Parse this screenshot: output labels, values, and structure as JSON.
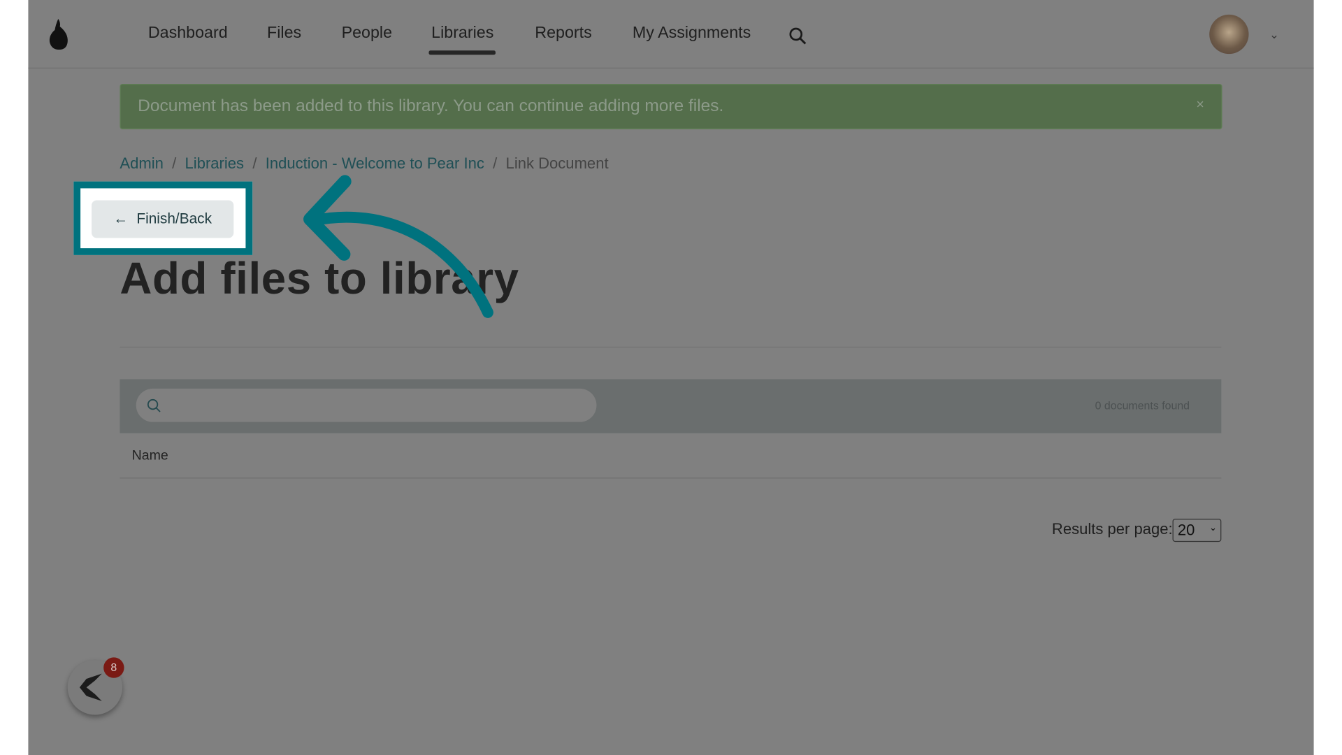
{
  "nav": {
    "items": [
      {
        "label": "Dashboard"
      },
      {
        "label": "Files"
      },
      {
        "label": "People"
      },
      {
        "label": "Libraries",
        "active": true
      },
      {
        "label": "Reports"
      },
      {
        "label": "My Assignments"
      }
    ],
    "search_icon": "search-icon",
    "logo": "pear-logo"
  },
  "alert": {
    "text": "Document has been added to this library. You can continue adding more files.",
    "close": "×",
    "color": "#546e4b"
  },
  "breadcrumb": {
    "items": [
      "Admin",
      "Libraries",
      "Induction - Welcome to Pear Inc"
    ],
    "current": "Link Document",
    "sep": "/"
  },
  "finish_button": {
    "icon": "←",
    "label": "Finish/Back"
  },
  "highlight_color": "#00727e",
  "title": "Add files to library",
  "search": {
    "placeholder": "",
    "count": "0 documents found"
  },
  "table": {
    "columns": [
      "Name"
    ]
  },
  "pagination": {
    "label": "Results per page:",
    "value": "20"
  },
  "widget": {
    "badge": "8"
  }
}
